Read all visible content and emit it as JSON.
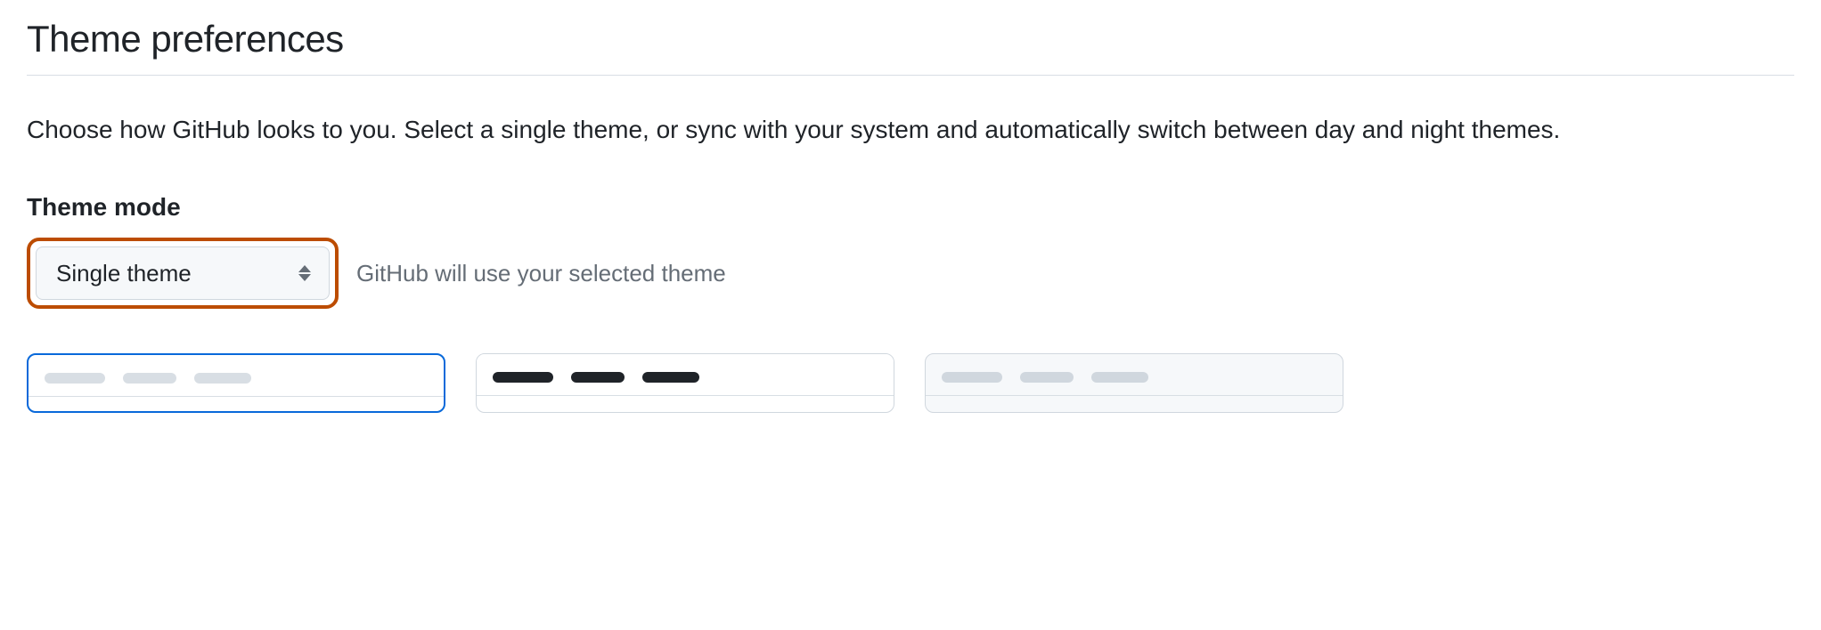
{
  "title": "Theme preferences",
  "description": "Choose how GitHub looks to you. Select a single theme, or sync with your system and automatically switch between day and night themes.",
  "themeMode": {
    "label": "Theme mode",
    "selected": "Single theme",
    "hint": "GitHub will use your selected theme"
  }
}
